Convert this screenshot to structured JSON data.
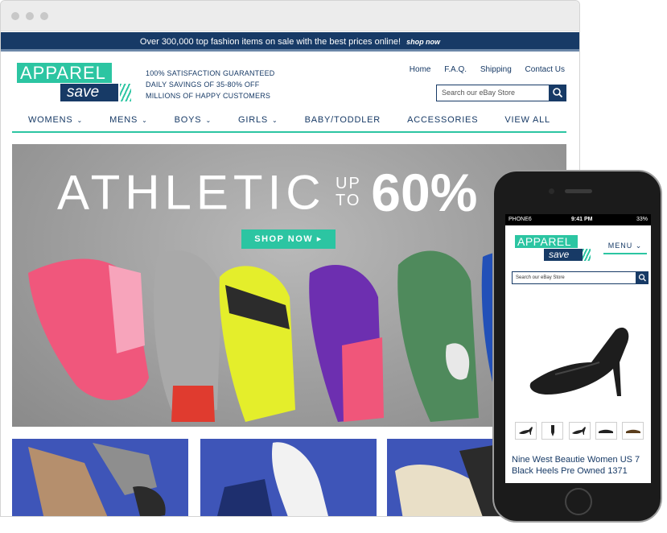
{
  "promo": {
    "text": "Over 300,000 top fashion items on sale with the best prices online!",
    "link": "shop now"
  },
  "logo": {
    "top": "APPAREL",
    "bottom": "save"
  },
  "taglines": [
    "100% SATISFACTION GUARANTEED",
    "DAILY SAVINGS OF 35-80% OFF",
    "MILLIONS OF HAPPY CUSTOMERS"
  ],
  "toplinks": [
    "Home",
    "F.A.Q.",
    "Shipping",
    "Contact Us"
  ],
  "search": {
    "placeholder": "Search our eBay Store"
  },
  "nav": [
    {
      "label": "WOMENS",
      "dropdown": true
    },
    {
      "label": "MENS",
      "dropdown": true
    },
    {
      "label": "BOYS",
      "dropdown": true
    },
    {
      "label": "GIRLS",
      "dropdown": true
    },
    {
      "label": "BABY/TODDLER",
      "dropdown": false
    },
    {
      "label": "ACCESSORIES",
      "dropdown": false
    },
    {
      "label": "VIEW ALL",
      "dropdown": false
    }
  ],
  "hero": {
    "word": "ATHLETIC",
    "up": "UP",
    "to": "TO",
    "offer": "60% OFF",
    "cta": "SHOP NOW"
  },
  "mobile": {
    "status": {
      "carrier": "PHONE6",
      "time": "9:41 PM",
      "battery": "33%"
    },
    "logo": {
      "top": "APPAREL",
      "bottom": "save"
    },
    "menu": "MENU",
    "search_placeholder": "Search our eBay Store",
    "product_title": "Nine West Beautie Women US 7 Black Heels Pre Owned 1371"
  },
  "colors": {
    "navy": "#173a66",
    "teal": "#2cc5a2",
    "tile_blue": "#3e55b8"
  }
}
